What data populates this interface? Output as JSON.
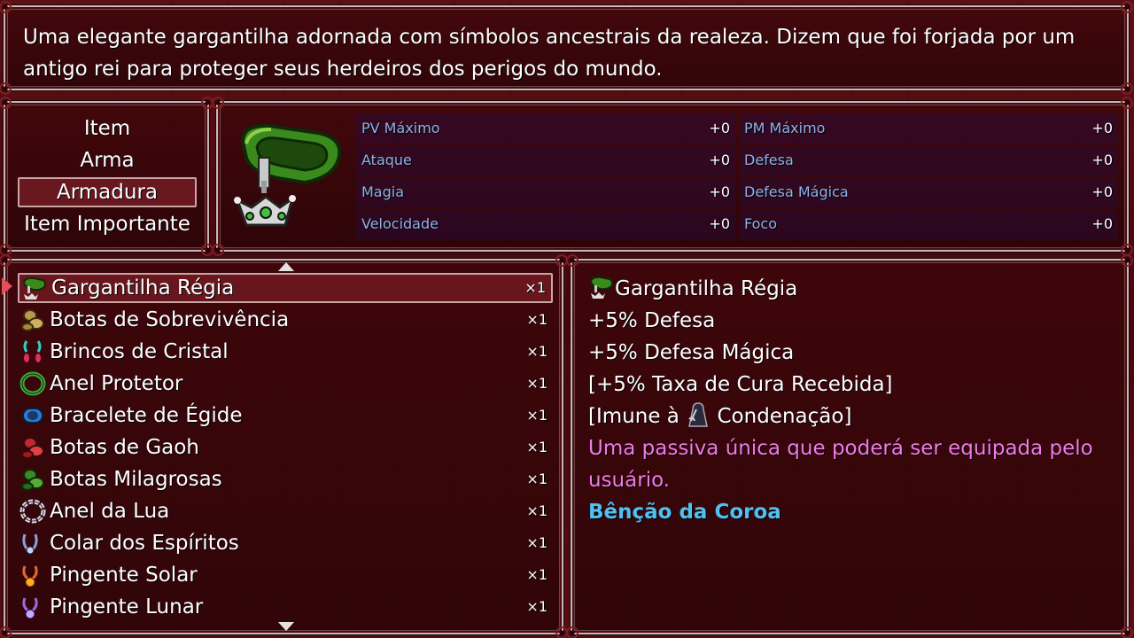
{
  "help": {
    "line1": "Uma elegante gargantilha adornada com símbolos ancestrais da realeza. Dizem que foi forjada por um",
    "line2": "antigo rei para proteger seus herdeiros dos perigos do mundo."
  },
  "categories": [
    {
      "label": "Item",
      "selected": false
    },
    {
      "label": "Arma",
      "selected": false
    },
    {
      "label": "Armadura",
      "selected": true
    },
    {
      "label": "Item Importante",
      "selected": false
    }
  ],
  "stats": [
    {
      "label": "PV Máximo",
      "value": "+0"
    },
    {
      "label": "PM Máximo",
      "value": "+0"
    },
    {
      "label": "Ataque",
      "value": "+0"
    },
    {
      "label": "Defesa",
      "value": "+0"
    },
    {
      "label": "Magia",
      "value": "+0"
    },
    {
      "label": "Defesa Mágica",
      "value": "+0"
    },
    {
      "label": "Velocidade",
      "value": "+0"
    },
    {
      "label": "Foco",
      "value": "+0"
    }
  ],
  "items": [
    {
      "name": "Gargantilha Régia",
      "qty": "×1",
      "icon": "choker-icon",
      "selected": true
    },
    {
      "name": "Botas de Sobrevivência",
      "qty": "×1",
      "icon": "boots-icon"
    },
    {
      "name": "Brincos de Cristal",
      "qty": "×1",
      "icon": "earrings-icon"
    },
    {
      "name": "Anel Protetor",
      "qty": "×1",
      "icon": "ring-icon"
    },
    {
      "name": "Bracelete de Égide",
      "qty": "×1",
      "icon": "bracelet-icon"
    },
    {
      "name": "Botas de Gaoh",
      "qty": "×1",
      "icon": "boots-icon"
    },
    {
      "name": "Botas Milagrosas",
      "qty": "×1",
      "icon": "boots-icon"
    },
    {
      "name": "Anel da Lua",
      "qty": "×1",
      "icon": "ring-icon"
    },
    {
      "name": "Colar dos Espíritos",
      "qty": "×1",
      "icon": "necklace-icon"
    },
    {
      "name": "Pingente Solar",
      "qty": "×1",
      "icon": "pendant-icon"
    },
    {
      "name": "Pingente Lunar",
      "qty": "×1",
      "icon": "pendant-icon"
    }
  ],
  "detail": {
    "name": "Gargantilha Régia",
    "effect1": "+5% Defesa",
    "effect2": "+5% Defesa Mágica",
    "effect3": "[+5% Taxa de Cura Recebida]",
    "immune_prefix": "[Imune à",
    "immune_suffix": "Condenação]",
    "passive_line1": "Uma passiva única que poderá ser equipada pelo",
    "passive_line2": "usuário.",
    "skill": "Bênção da Coroa"
  },
  "colors": {
    "stat_label": "#8fb2e8",
    "passive_text": "#f07ae8",
    "skill_text": "#4fc0f0"
  }
}
